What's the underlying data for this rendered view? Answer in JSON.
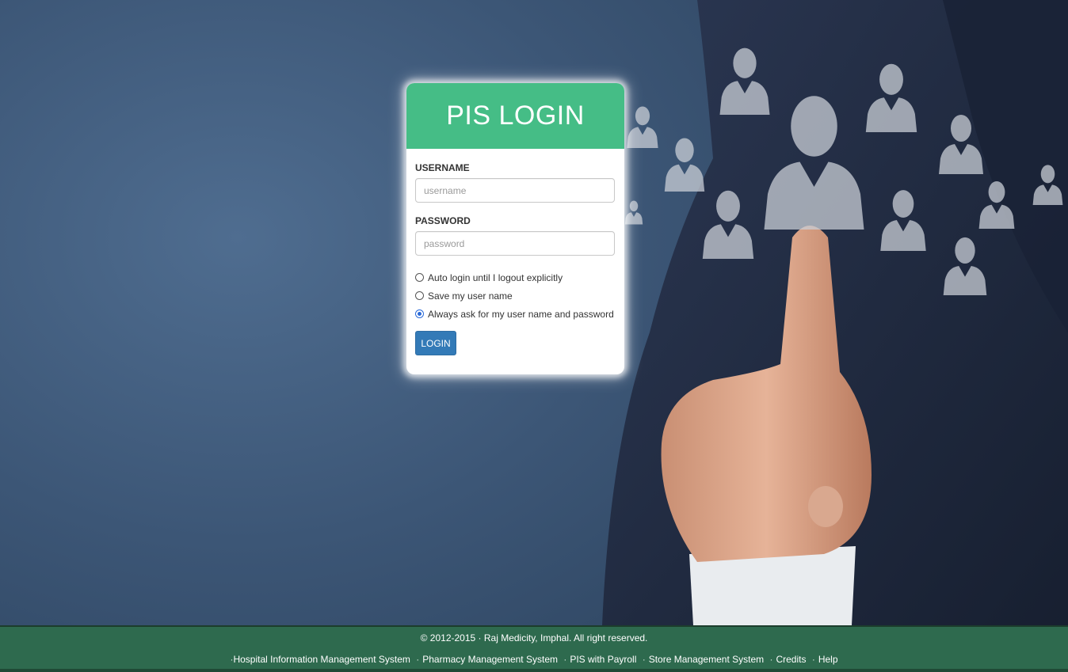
{
  "login": {
    "title": "PIS LOGIN",
    "username_label": "USERNAME",
    "username_placeholder": "username",
    "username_value": "",
    "password_label": "PASSWORD",
    "password_placeholder": "password",
    "password_value": "",
    "options": [
      {
        "label": "Auto login until I logout explicitly",
        "selected": false
      },
      {
        "label": "Save my user name",
        "selected": false
      },
      {
        "label": "Always ask for my user name and password",
        "selected": true
      }
    ],
    "submit_label": "LOGIN"
  },
  "footer": {
    "copyright": "© 2012-2015 · Raj Medicity, Imphal. All right reserved.",
    "links": [
      "Hospital Information Management System",
      "Pharmacy Management System",
      "PIS with Payroll",
      "Store Management System",
      "Credits",
      "Help"
    ]
  },
  "colors": {
    "header_green": "#45bd86",
    "button_blue": "#337ab7",
    "footer_green": "#2e6a4e",
    "background_blue": "#3d5878"
  }
}
